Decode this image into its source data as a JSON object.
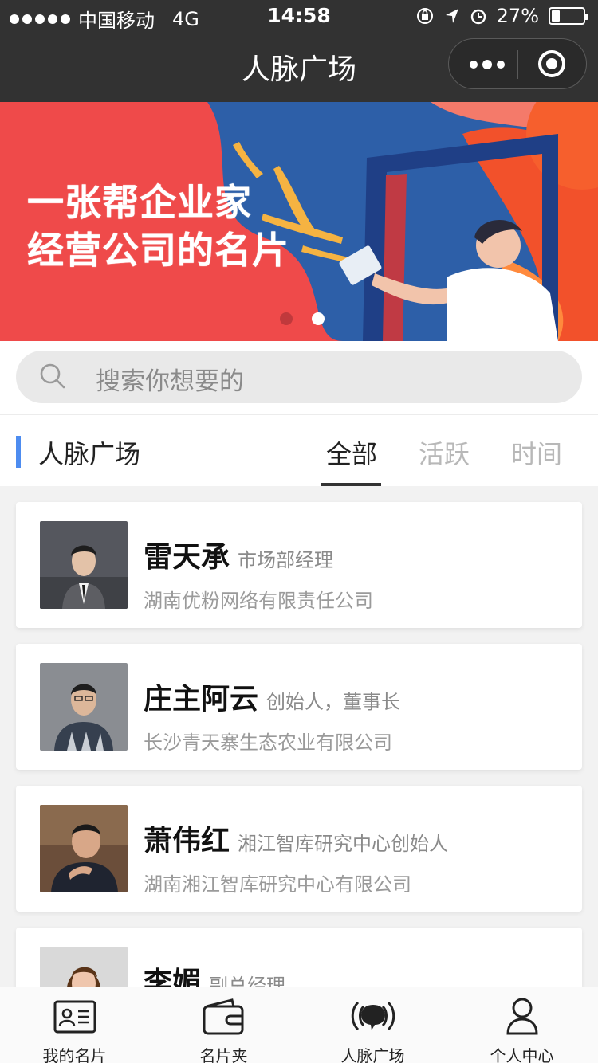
{
  "status_bar": {
    "carrier": "中国移动",
    "network": "4G",
    "time": "14:58",
    "battery": "27%",
    "battery_level": 0.27
  },
  "nav": {
    "title": "人脉广场"
  },
  "banner": {
    "line1": "一张帮企业家",
    "line2": "经营公司的名片",
    "slide_count": 2,
    "active_slide": 2
  },
  "search": {
    "placeholder": "搜索你想要的"
  },
  "section": {
    "title": "人脉广场",
    "tabs": [
      "全部",
      "活跃",
      "时间"
    ],
    "active_tab": 0
  },
  "people": [
    {
      "name": "雷天承",
      "role": "市场部经理",
      "company": "湖南优粉网络有限责任公司"
    },
    {
      "name": "庄主阿云",
      "role": "创始人，董事长",
      "company": "长沙青天寨生态农业有限公司"
    },
    {
      "name": "萧伟红",
      "role": "湘江智库研究中心创始人",
      "company": "湖南湘江智库研究中心有限公司"
    },
    {
      "name": "李媚",
      "role": "副总经理",
      "company": ""
    }
  ],
  "tabbar": [
    {
      "label": "我的名片",
      "icon": "card-icon"
    },
    {
      "label": "名片夹",
      "icon": "wallet-icon"
    },
    {
      "label": "人脉广场",
      "icon": "chat-broadcast-icon"
    },
    {
      "label": "个人中心",
      "icon": "person-icon"
    }
  ],
  "colors": {
    "nav_bg": "#323232",
    "banner_bg": "#ef4a4a",
    "accent": "#4d8cf0",
    "blue_shape": "#2d5fa8"
  }
}
